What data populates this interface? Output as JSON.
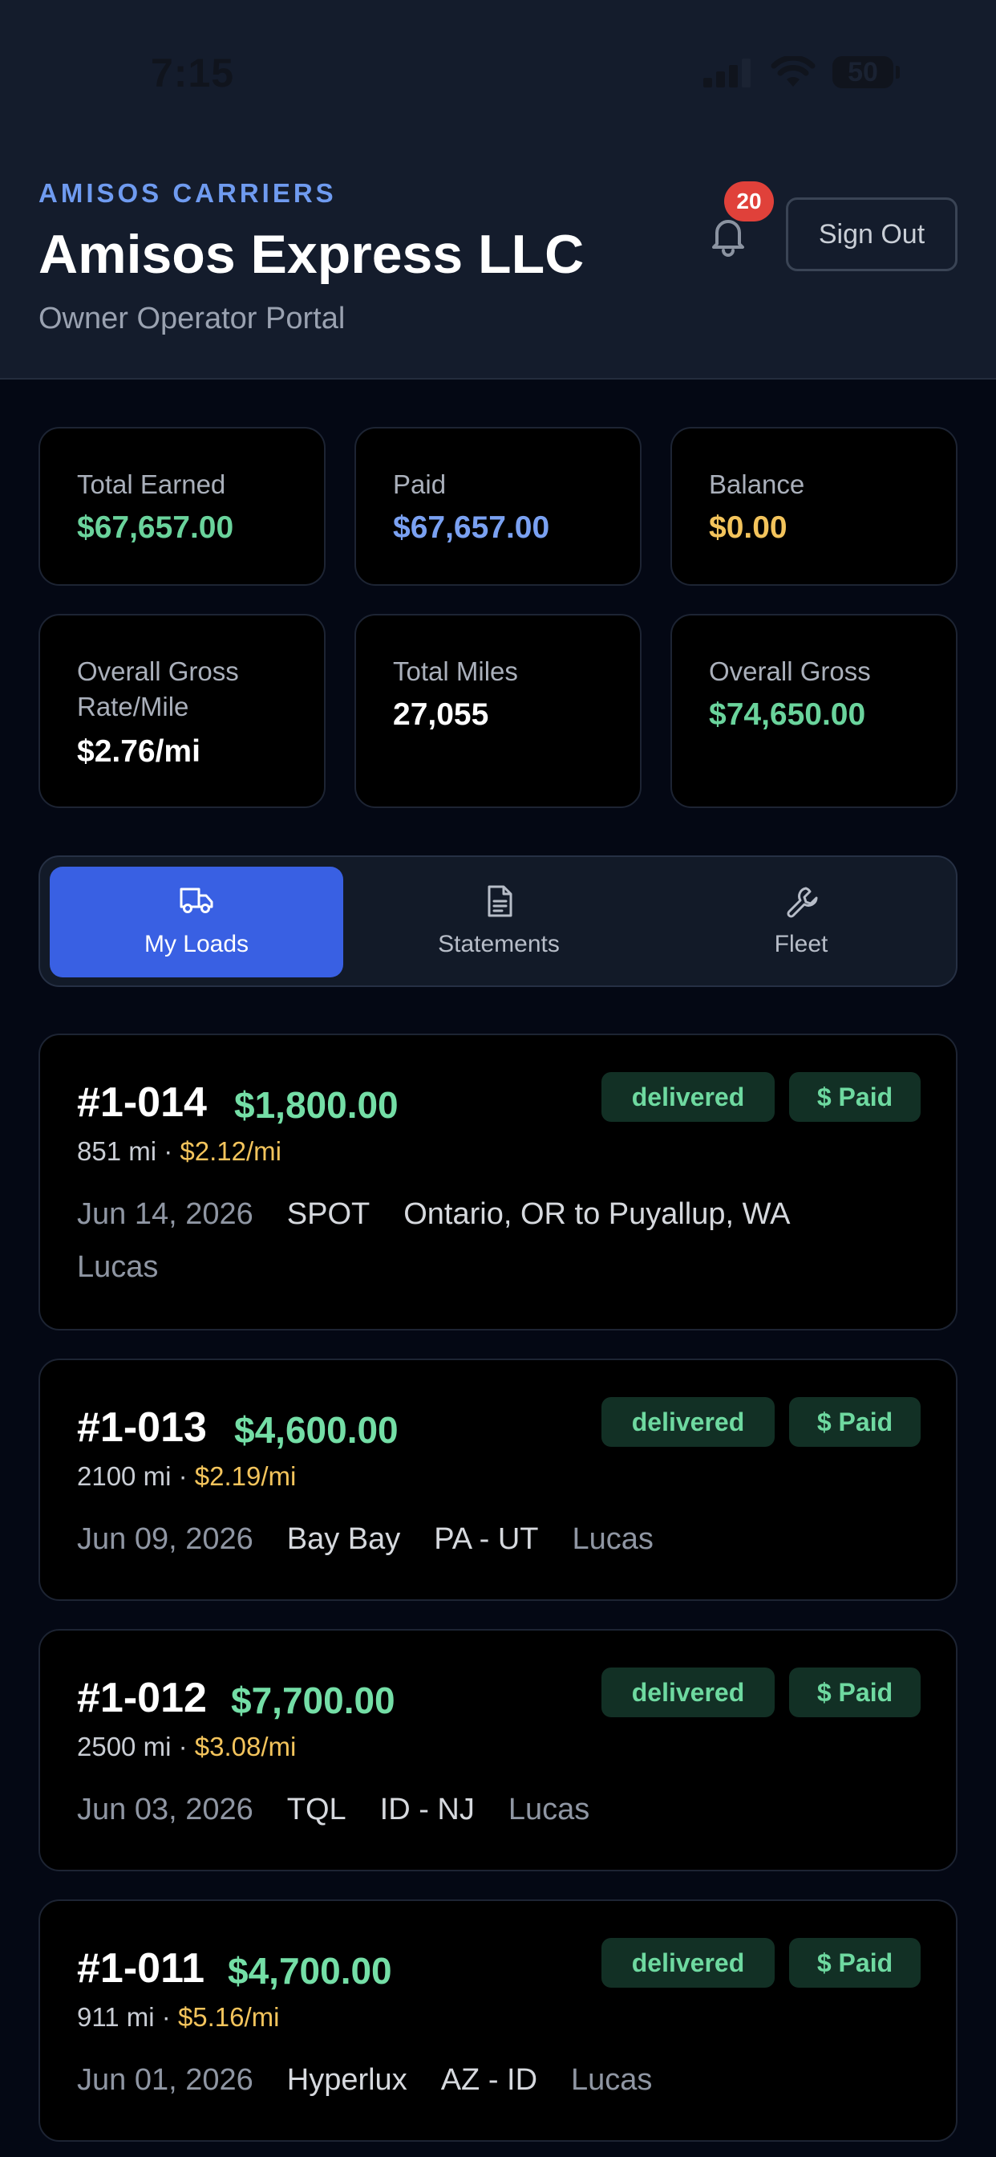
{
  "status_bar": {
    "time": "7:15",
    "battery": "50"
  },
  "header": {
    "brand": "AMISOS CARRIERS",
    "company": "Amisos Express LLC",
    "portal": "Owner Operator Portal",
    "notification_count": "20",
    "sign_out_label": "Sign Out"
  },
  "stats": [
    {
      "label": "Total Earned",
      "value": "$67,657.00",
      "color": "#6ad39c"
    },
    {
      "label": "Paid",
      "value": "$67,657.00",
      "color": "#7aa1f2"
    },
    {
      "label": "Balance",
      "value": "$0.00",
      "color": "#f3c45c"
    },
    {
      "label": "Overall Gross Rate/Mile",
      "value": "$2.76/mi",
      "color": "#ffffff"
    },
    {
      "label": "Total Miles",
      "value": "27,055",
      "color": "#ffffff"
    },
    {
      "label": "Overall Gross",
      "value": "$74,650.00",
      "color": "#6ad39c"
    }
  ],
  "tabs": [
    {
      "label": "My Loads",
      "icon": "truck-icon",
      "active": true
    },
    {
      "label": "Statements",
      "icon": "document-icon",
      "active": false
    },
    {
      "label": "Fleet",
      "icon": "wrench-icon",
      "active": false
    }
  ],
  "loads": [
    {
      "id": "#1-014",
      "amount": "$1,800.00",
      "status": "delivered",
      "payment": "$ Paid",
      "miles": "851 mi",
      "rate": "$2.12/mi",
      "date": "Jun 14, 2026",
      "broker": "SPOT",
      "route": "Ontario, OR to Puyallup, WA",
      "driver": "Lucas"
    },
    {
      "id": "#1-013",
      "amount": "$4,600.00",
      "status": "delivered",
      "payment": "$ Paid",
      "miles": "2100 mi",
      "rate": "$2.19/mi",
      "date": "Jun 09, 2026",
      "broker": "Bay Bay",
      "route": "PA - UT",
      "driver": "Lucas"
    },
    {
      "id": "#1-012",
      "amount": "$7,700.00",
      "status": "delivered",
      "payment": "$ Paid",
      "miles": "2500 mi",
      "rate": "$3.08/mi",
      "date": "Jun 03, 2026",
      "broker": "TQL",
      "route": "ID - NJ",
      "driver": "Lucas"
    },
    {
      "id": "#1-011",
      "amount": "$4,700.00",
      "status": "delivered",
      "payment": "$ Paid",
      "miles": "911 mi",
      "rate": "$5.16/mi",
      "date": "Jun 01, 2026",
      "broker": "Hyperlux",
      "route": "AZ - ID",
      "driver": "Lucas"
    }
  ]
}
